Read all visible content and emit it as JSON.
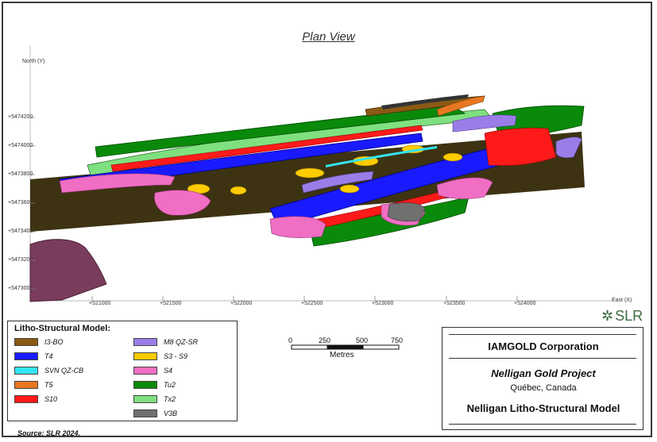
{
  "title": "Plan View",
  "axes": {
    "y_label": "North (Y)",
    "x_label": "East (X)",
    "y_ticks": [
      "+5474200",
      "+5474000",
      "+5473800",
      "+5473600",
      "+5473400",
      "+5473200",
      "+5473000"
    ],
    "x_ticks": [
      "+521000",
      "+521500",
      "+522000",
      "+522500",
      "+523000",
      "+523500",
      "+524000"
    ]
  },
  "legend": {
    "title": "Litho-Structural Model:",
    "items": [
      {
        "label": "I3-BO",
        "color": "#8b5a14"
      },
      {
        "label": "T4",
        "color": "#1a1aff"
      },
      {
        "label": "SVN QZ-CB",
        "color": "#33e6f0"
      },
      {
        "label": "T5",
        "color": "#e87722"
      },
      {
        "label": "S10",
        "color": "#ff1a1a"
      },
      {
        "label": "M8 QZ-SR",
        "color": "#9b7de8"
      },
      {
        "label": "S3 - S9",
        "color": "#ffcc00"
      },
      {
        "label": "S4",
        "color": "#f06ec4"
      },
      {
        "label": "Tu2",
        "color": "#0a8a0a"
      },
      {
        "label": "Tx2",
        "color": "#7fe07f"
      },
      {
        "label": "V3B",
        "color": "#707070"
      }
    ]
  },
  "scale": {
    "ticks": [
      "0",
      "250",
      "500",
      "750"
    ],
    "unit": "Metres"
  },
  "logo": {
    "text": "SLR",
    "color": "#3e6c40"
  },
  "title_block": {
    "company": "IAMGOLD Corporation",
    "project": "Nelligan Gold Project",
    "location": "Québec, Canada",
    "model": "Nelligan Litho-Structural Model"
  },
  "source": "Source:  SLR 2024.",
  "colors": {
    "background_slab": "#3d3312",
    "dyke": "#7a3c5c"
  }
}
